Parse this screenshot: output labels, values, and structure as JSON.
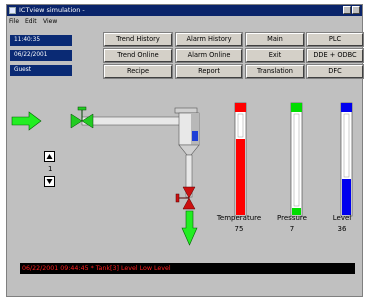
{
  "window": {
    "title": "ICTview simulation -",
    "menu": [
      "File",
      "Edit",
      "View"
    ]
  },
  "info": {
    "time": "11:40:35",
    "date": "06/22/2001",
    "user": "Guest"
  },
  "buttons": {
    "trend_history": "Trend History",
    "alarm_history": "Alarm History",
    "main": "Main",
    "plc": "PLC",
    "trend_online": "Trend Online",
    "alarm_online": "Alarm Online",
    "exit": "Exit",
    "dde_odbc": "DDE + ODBC",
    "recipe": "Recipe",
    "report": "Report",
    "translation": "Translation",
    "dfc": "DFC"
  },
  "counter": {
    "value": "1"
  },
  "gauges": [
    {
      "label": "Temperature",
      "value": "75",
      "fill": 0.75,
      "color": "#ff0000"
    },
    {
      "label": "Pressure",
      "value": "7",
      "fill": 0.07,
      "color": "#00dd00"
    },
    {
      "label": "Level",
      "value": "36",
      "fill": 0.36,
      "color": "#0000ee"
    }
  ],
  "alarm": {
    "message": "06/22/2001 09:44:45 * Tank[3] Level Low Level"
  },
  "colors": {
    "pipe_arrow": "#22ee22",
    "valve_top": "#22cc22",
    "valve_bottom": "#cc1111",
    "tank_level": "#1f3fd6"
  },
  "icons": {
    "up": "triangle-up-icon",
    "down": "triangle-down-icon"
  }
}
